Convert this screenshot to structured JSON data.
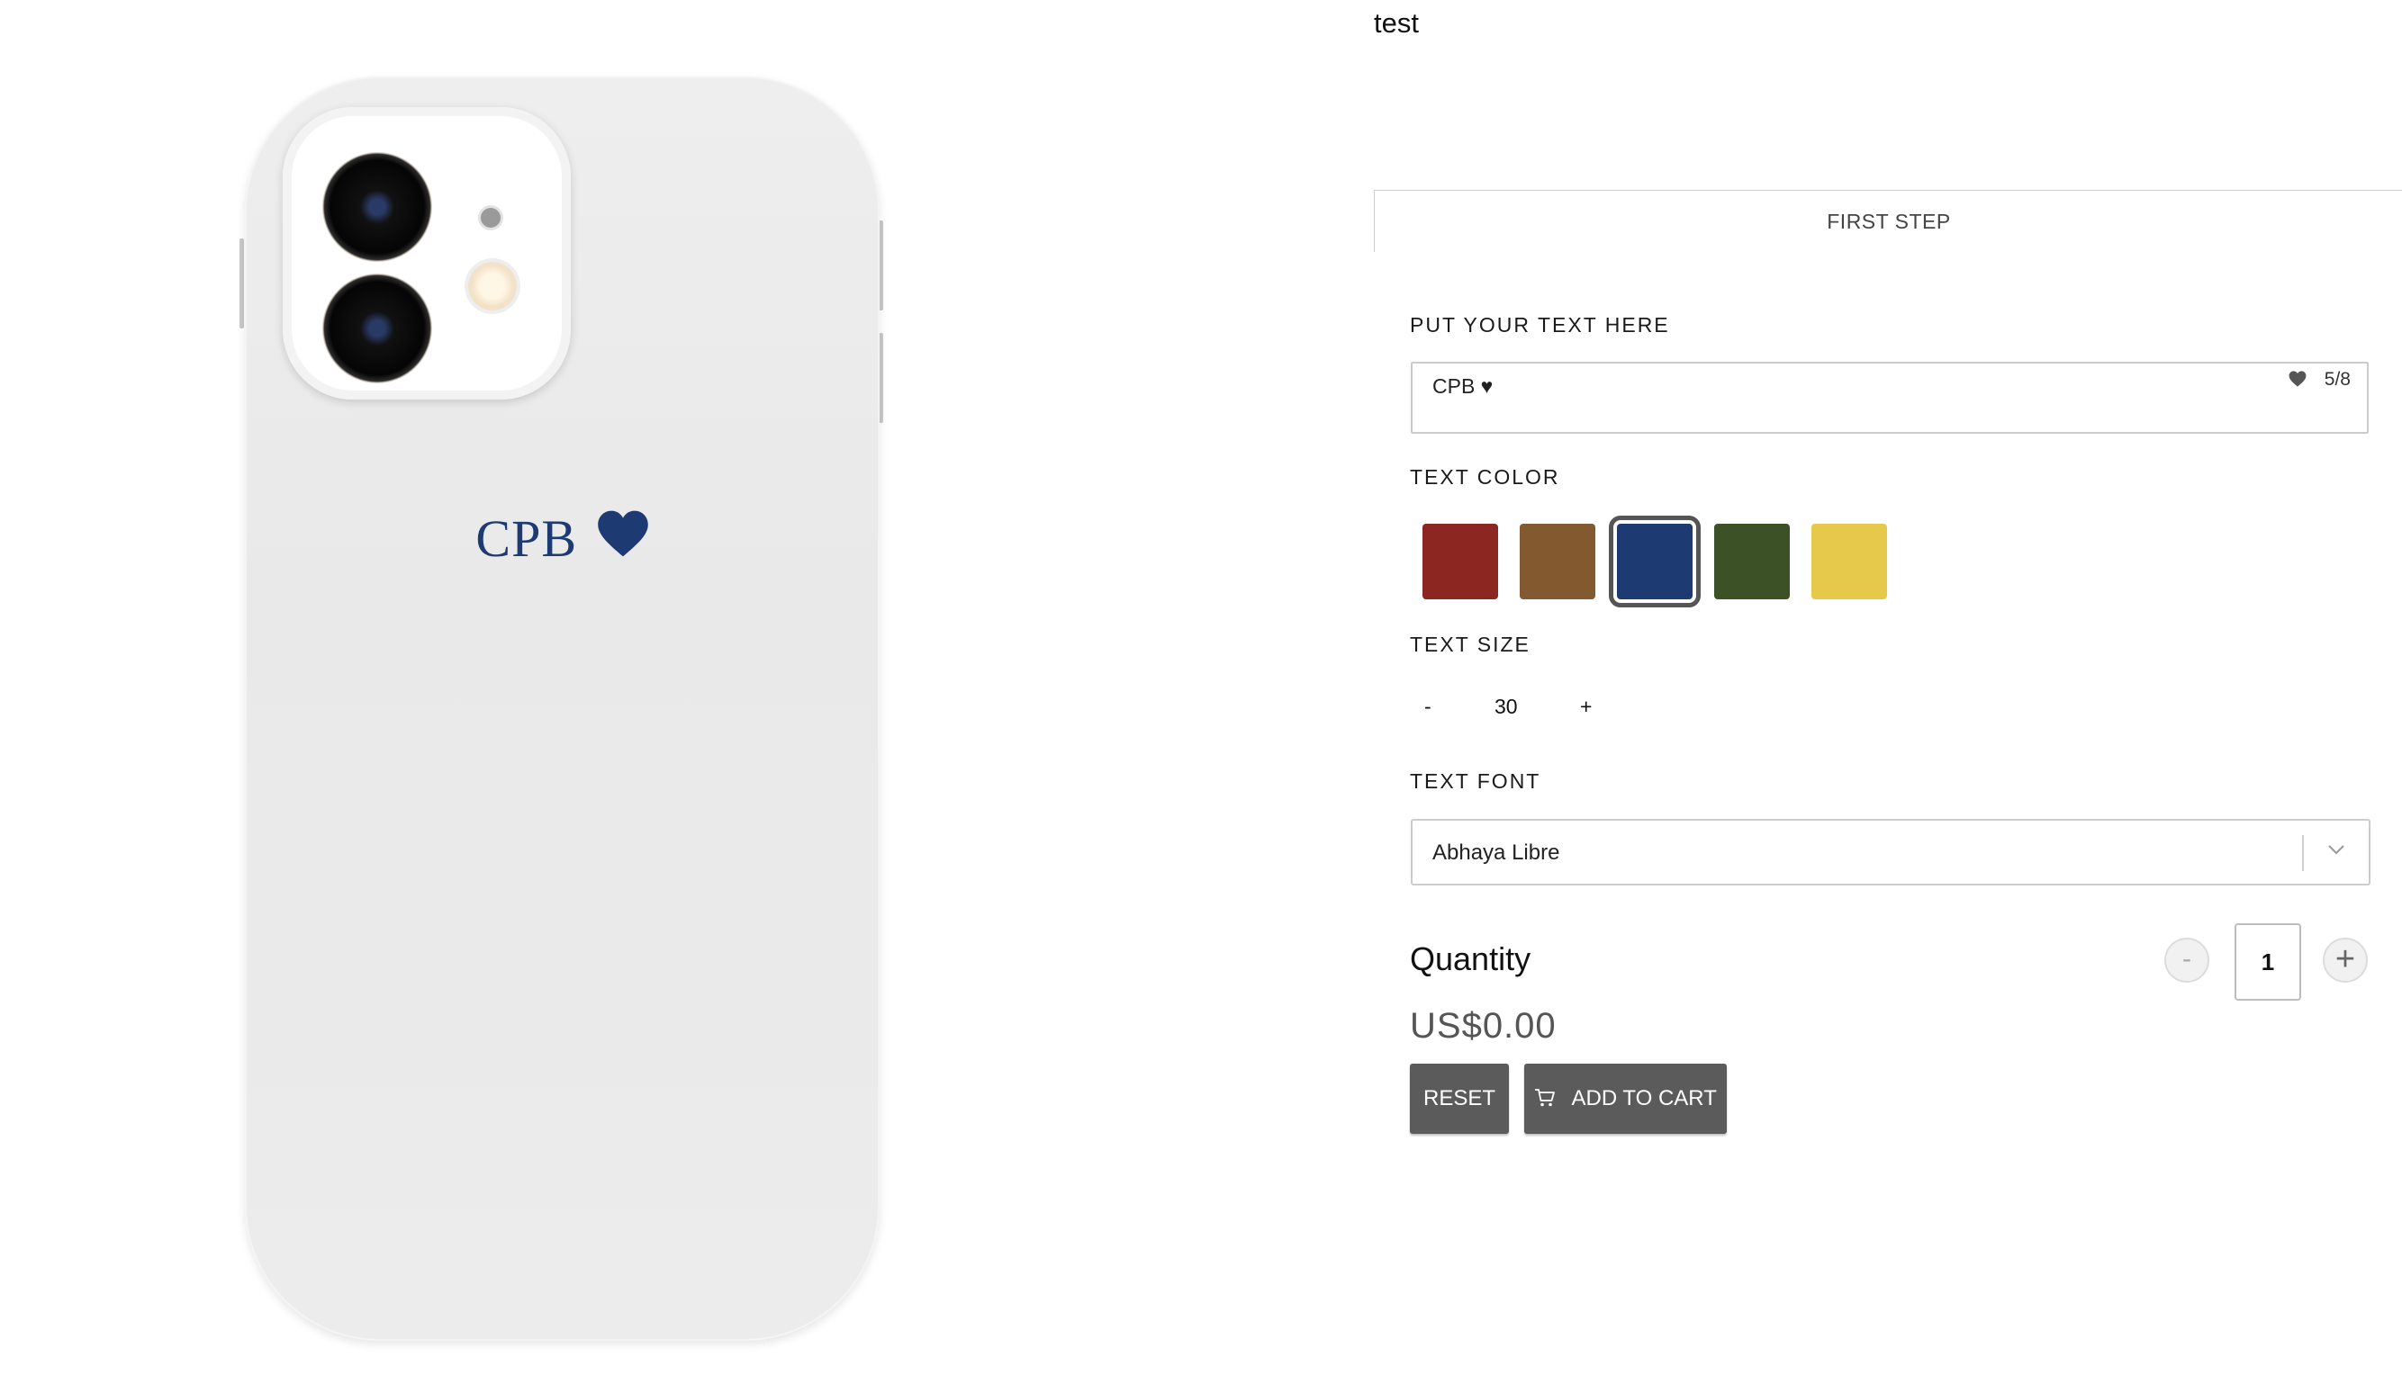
{
  "product": {
    "title": "test"
  },
  "preview": {
    "case_text": "CPB",
    "case_text_color": "#1e3a73",
    "case_heart_icon": "heart-icon"
  },
  "steps": {
    "current": "FIRST STEP"
  },
  "customizer": {
    "text_label": "PUT YOUR TEXT HERE",
    "text_value": "CPB ♥",
    "counter_icon": "heart-icon",
    "char_count": "5/8",
    "color_label": "TEXT COLOR",
    "colors": [
      {
        "name": "red",
        "hex": "#8b2621",
        "selected": false
      },
      {
        "name": "brown",
        "hex": "#835930",
        "selected": false
      },
      {
        "name": "navy",
        "hex": "#1e3a73",
        "selected": true
      },
      {
        "name": "green",
        "hex": "#3d5127",
        "selected": false
      },
      {
        "name": "yellow",
        "hex": "#e6c94a",
        "selected": false
      }
    ],
    "size_label": "TEXT SIZE",
    "size_minus": "-",
    "size_value": "30",
    "size_plus": "+",
    "font_label": "TEXT FONT",
    "font_value": "Abhaya Libre"
  },
  "purchase": {
    "quantity_label": "Quantity",
    "qty_minus": "-",
    "qty_value": "1",
    "qty_plus": "+",
    "price": "US$0.00",
    "reset_label": "RESET",
    "add_to_cart_label": "ADD TO CART",
    "cart_icon": "cart-icon"
  }
}
